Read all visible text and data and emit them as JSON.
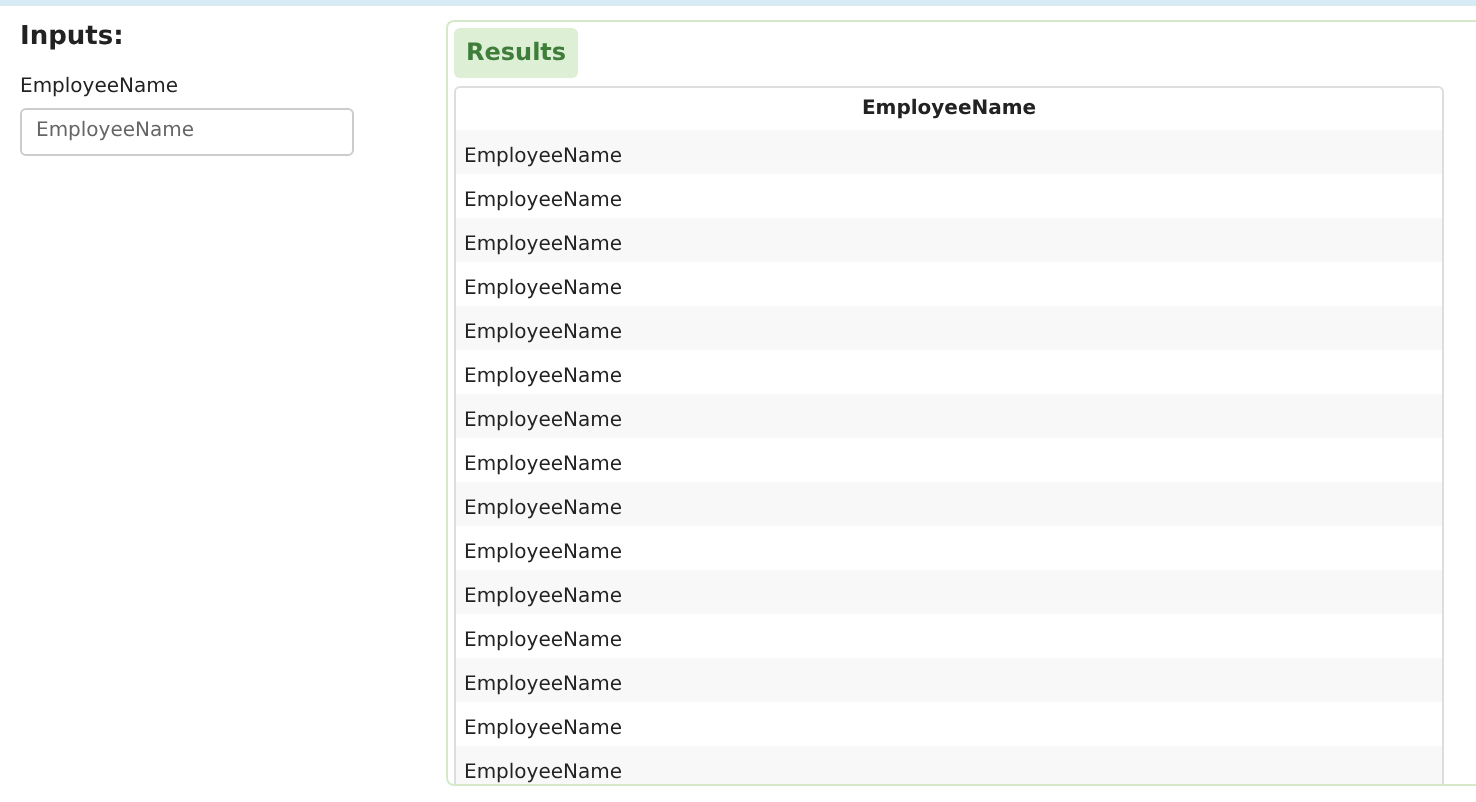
{
  "inputs": {
    "title": "Inputs:",
    "fields": [
      {
        "label": "EmployeeName",
        "placeholder": "EmployeeName"
      }
    ]
  },
  "results": {
    "title": "Results",
    "columns": [
      "EmployeeName"
    ],
    "rows": [
      [
        "EmployeeName"
      ],
      [
        "EmployeeName"
      ],
      [
        "EmployeeName"
      ],
      [
        "EmployeeName"
      ],
      [
        "EmployeeName"
      ],
      [
        "EmployeeName"
      ],
      [
        "EmployeeName"
      ],
      [
        "EmployeeName"
      ],
      [
        "EmployeeName"
      ],
      [
        "EmployeeName"
      ],
      [
        "EmployeeName"
      ],
      [
        "EmployeeName"
      ],
      [
        "EmployeeName"
      ],
      [
        "EmployeeName"
      ],
      [
        "EmployeeName"
      ]
    ]
  }
}
